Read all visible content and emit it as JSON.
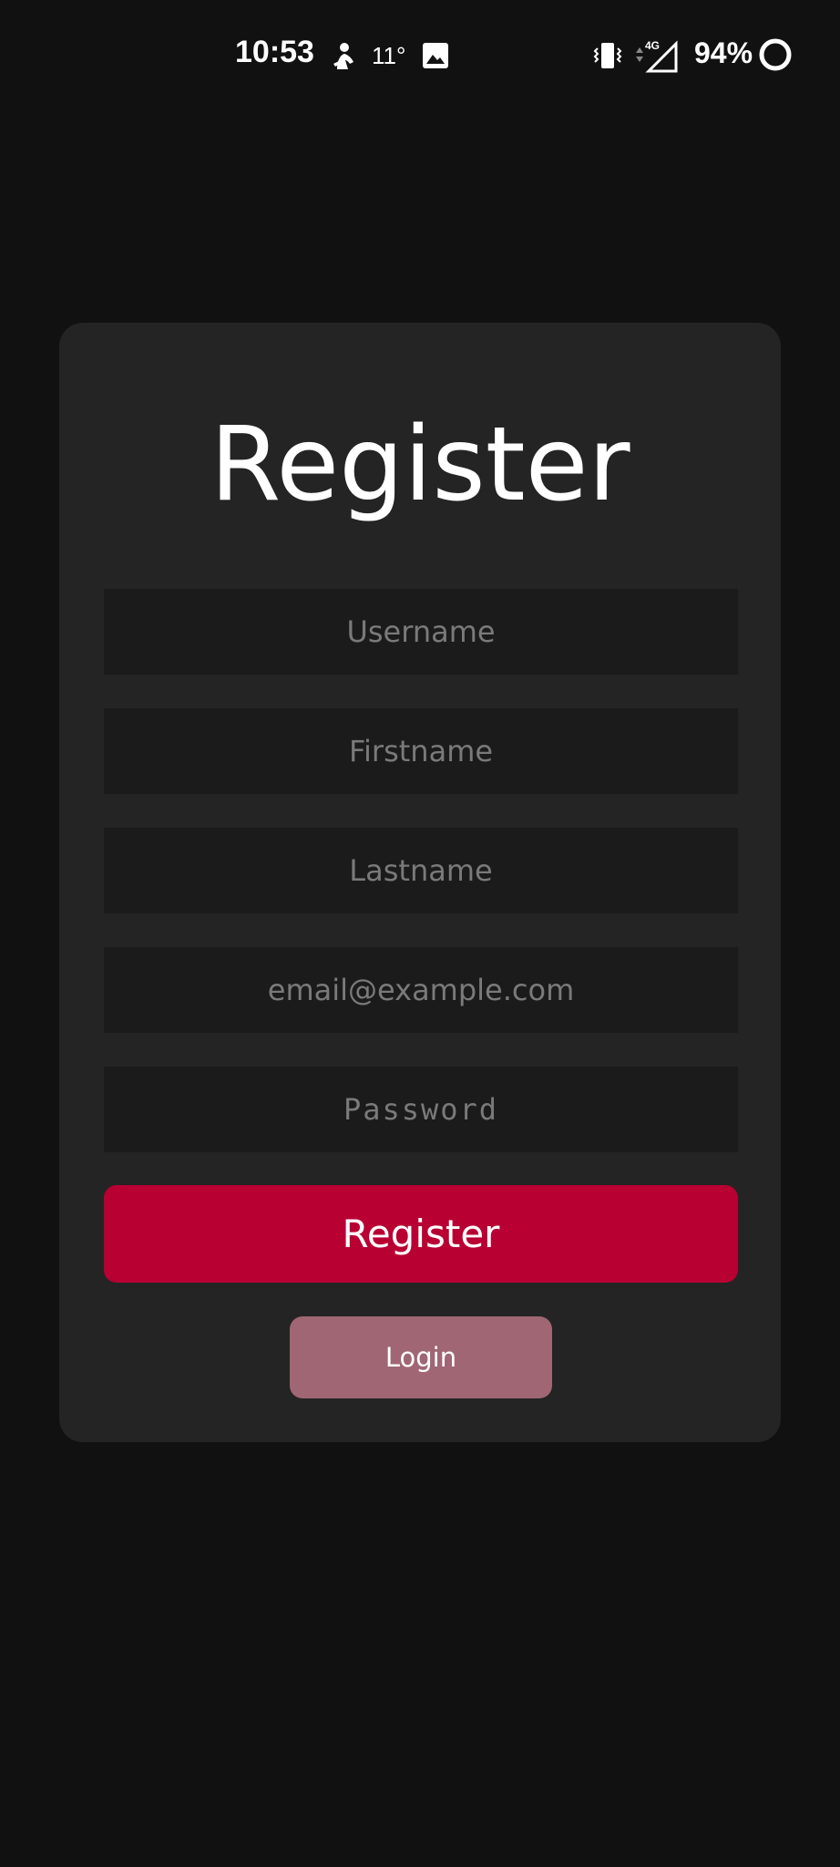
{
  "status_bar": {
    "time": "10:53",
    "temperature": "11°",
    "battery": "94%",
    "network": "4G",
    "icons": [
      "weather-icon",
      "image-icon",
      "vibrate-icon",
      "signal-icon",
      "battery-icon"
    ]
  },
  "form": {
    "title": "Register",
    "fields": {
      "username": {
        "placeholder": "Username",
        "value": ""
      },
      "firstname": {
        "placeholder": "Firstname",
        "value": ""
      },
      "lastname": {
        "placeholder": "Lastname",
        "value": ""
      },
      "email": {
        "placeholder": "email@example.com",
        "value": ""
      },
      "password": {
        "placeholder": "Password",
        "value": ""
      }
    },
    "register_label": "Register",
    "login_label": "Login"
  },
  "colors": {
    "background": "#111111",
    "card": "#242424",
    "field": "#1b1b1b",
    "primary": "#b80033",
    "secondary": "#a06674"
  }
}
